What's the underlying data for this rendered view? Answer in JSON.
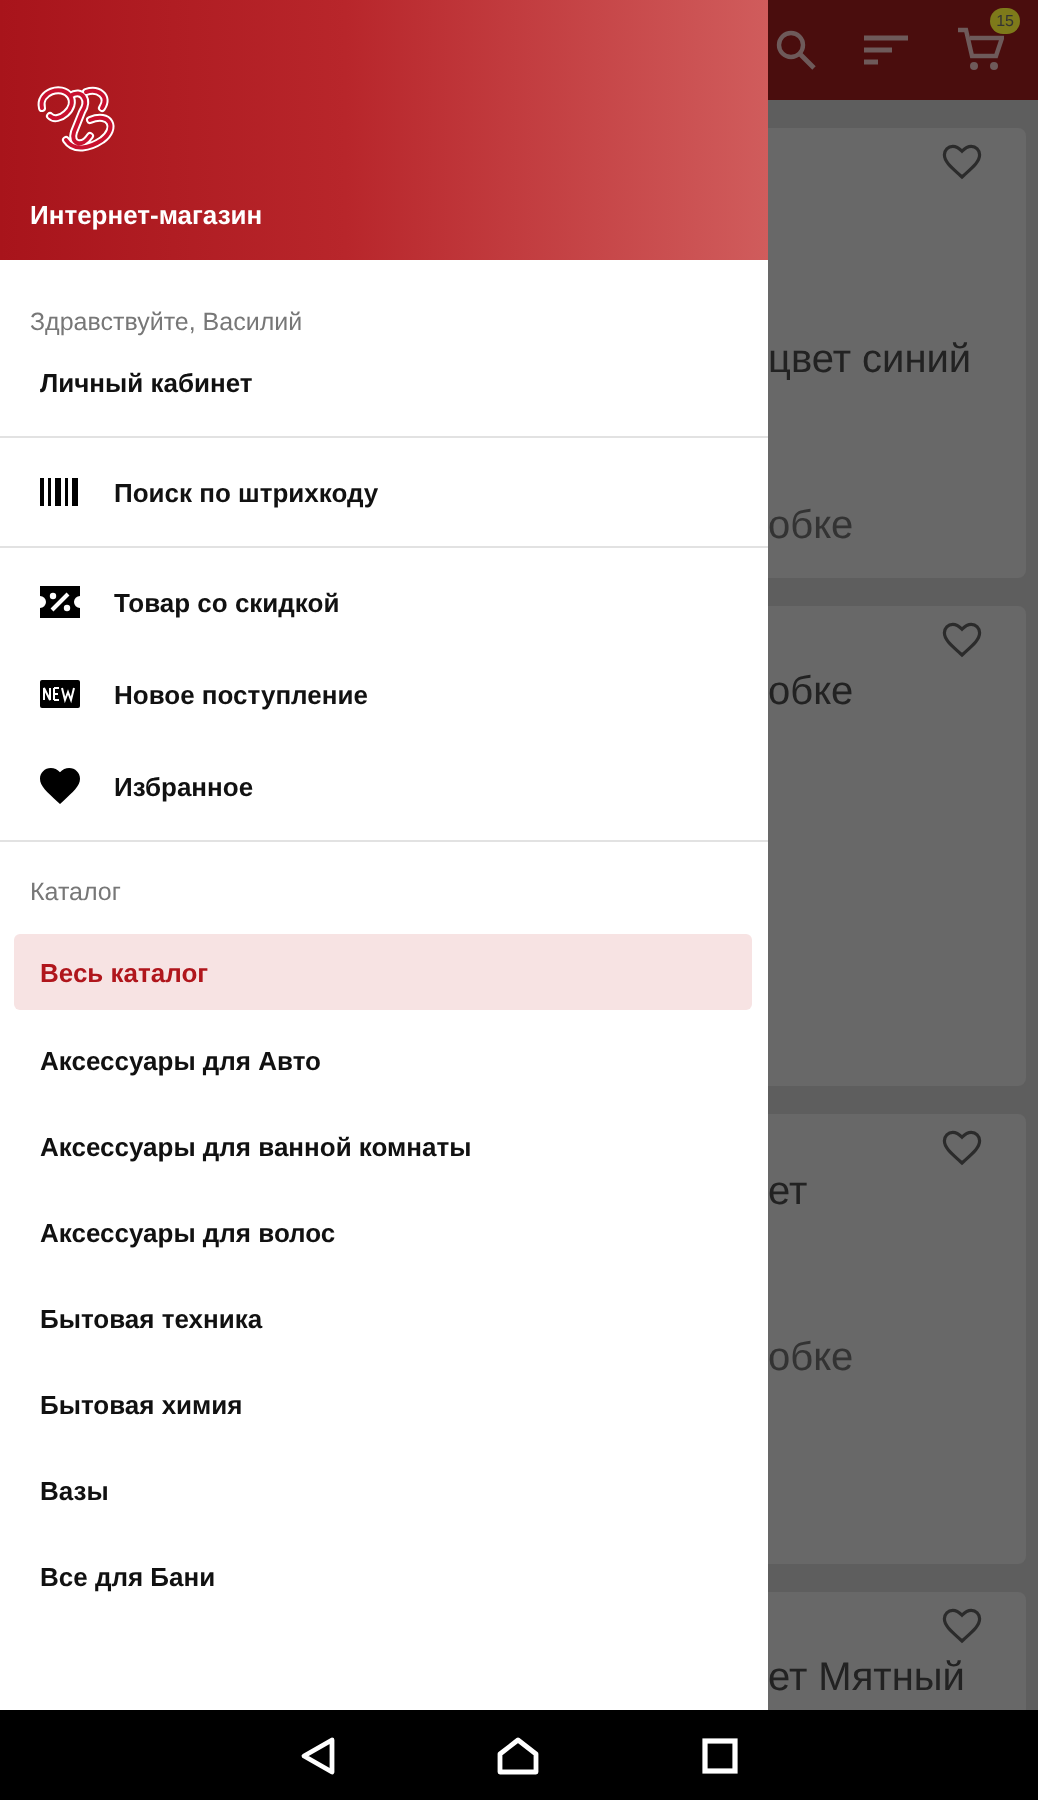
{
  "drawer": {
    "header": {
      "subtitle": "Интернет-магазин"
    },
    "greeting": "Здравствуйте, Василий",
    "sections": [
      {
        "items": [
          {
            "label": "Личный кабинет",
            "kind": "plain"
          }
        ]
      },
      {
        "items": [
          {
            "label": "Поиск по штрихкоду",
            "kind": "barcode"
          }
        ]
      },
      {
        "items": [
          {
            "label": "Товар со скидкой",
            "kind": "discount"
          },
          {
            "label": "Новое поступление",
            "kind": "new"
          },
          {
            "label": "Избранное",
            "kind": "heart"
          }
        ]
      }
    ],
    "catalog": {
      "title": "Каталог",
      "items": [
        {
          "label": "Весь каталог",
          "selected": true
        },
        {
          "label": "Аксессуары для Авто",
          "selected": false
        },
        {
          "label": "Аксессуары для ванной комнаты",
          "selected": false
        },
        {
          "label": "Аксессуары для волос",
          "selected": false
        },
        {
          "label": "Бытовая техника",
          "selected": false
        },
        {
          "label": "Бытовая химия",
          "selected": false
        },
        {
          "label": "Вазы",
          "selected": false
        },
        {
          "label": "Все для Бани",
          "selected": false
        }
      ]
    }
  },
  "background": {
    "cart_badge": "15",
    "cards": [
      {
        "lines": [
          "цвет синий",
          "обке"
        ]
      },
      {
        "lines": [
          "обке"
        ]
      },
      {
        "lines": [
          "ет",
          "обке"
        ]
      },
      {
        "lines": [
          "ет Мятный"
        ]
      }
    ]
  }
}
